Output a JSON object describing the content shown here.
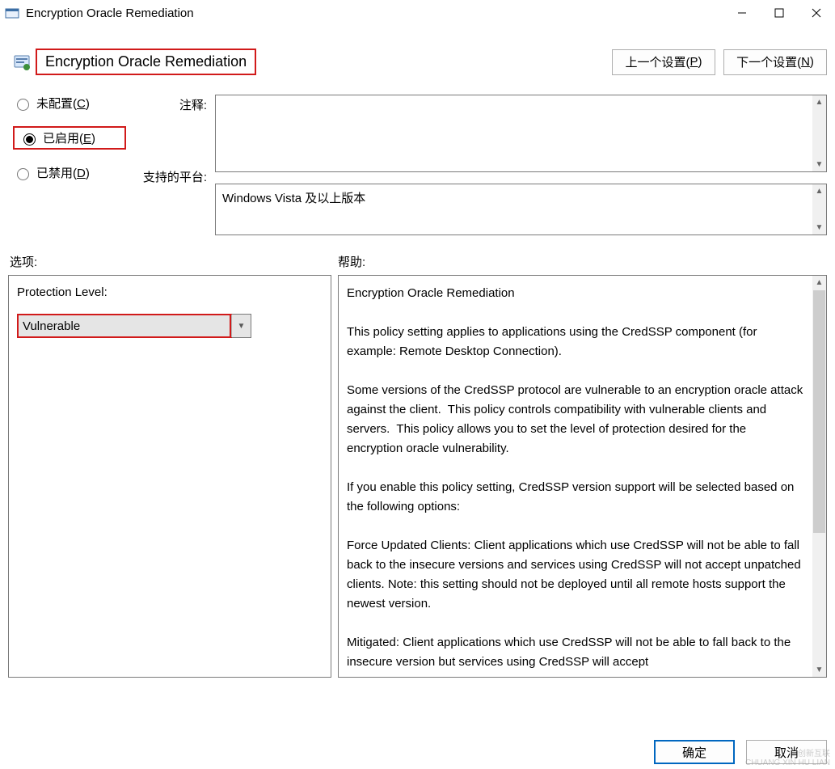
{
  "window": {
    "title": "Encryption Oracle Remediation"
  },
  "header": {
    "policy_title": "Encryption Oracle Remediation",
    "prev_btn_prefix": "上一个设置(",
    "prev_btn_key": "P",
    "prev_btn_suffix": ")",
    "next_btn_prefix": "下一个设置(",
    "next_btn_key": "N",
    "next_btn_suffix": ")"
  },
  "radios": {
    "not_configured_prefix": "未配置(",
    "not_configured_key": "C",
    "not_configured_suffix": ")",
    "enabled_prefix": "已启用(",
    "enabled_key": "E",
    "enabled_suffix": ")",
    "disabled_prefix": "已禁用(",
    "disabled_key": "D",
    "disabled_suffix": ")",
    "selected": "enabled"
  },
  "labels": {
    "comment": "注释:",
    "supported": "支持的平台:",
    "options": "选项:",
    "help": "帮助:"
  },
  "fields": {
    "comment_value": "",
    "supported_value": "Windows Vista 及以上版本"
  },
  "options": {
    "protection_label": "Protection Level:",
    "protection_value": "Vulnerable"
  },
  "help_text": "Encryption Oracle Remediation\n\nThis policy setting applies to applications using the CredSSP component (for example: Remote Desktop Connection).\n\nSome versions of the CredSSP protocol are vulnerable to an encryption oracle attack against the client.  This policy controls compatibility with vulnerable clients and servers.  This policy allows you to set the level of protection desired for the encryption oracle vulnerability.\n\nIf you enable this policy setting, CredSSP version support will be selected based on the following options:\n\nForce Updated Clients: Client applications which use CredSSP will not be able to fall back to the insecure versions and services using CredSSP will not accept unpatched clients. Note: this setting should not be deployed until all remote hosts support the newest version.\n\nMitigated: Client applications which use CredSSP will not be able to fall back to the insecure version but services using CredSSP will accept",
  "buttons": {
    "ok": "确定",
    "cancel": "取消"
  },
  "watermark": {
    "line1": "创新互联",
    "line2": "CHUANG XIN HU LIAN"
  }
}
